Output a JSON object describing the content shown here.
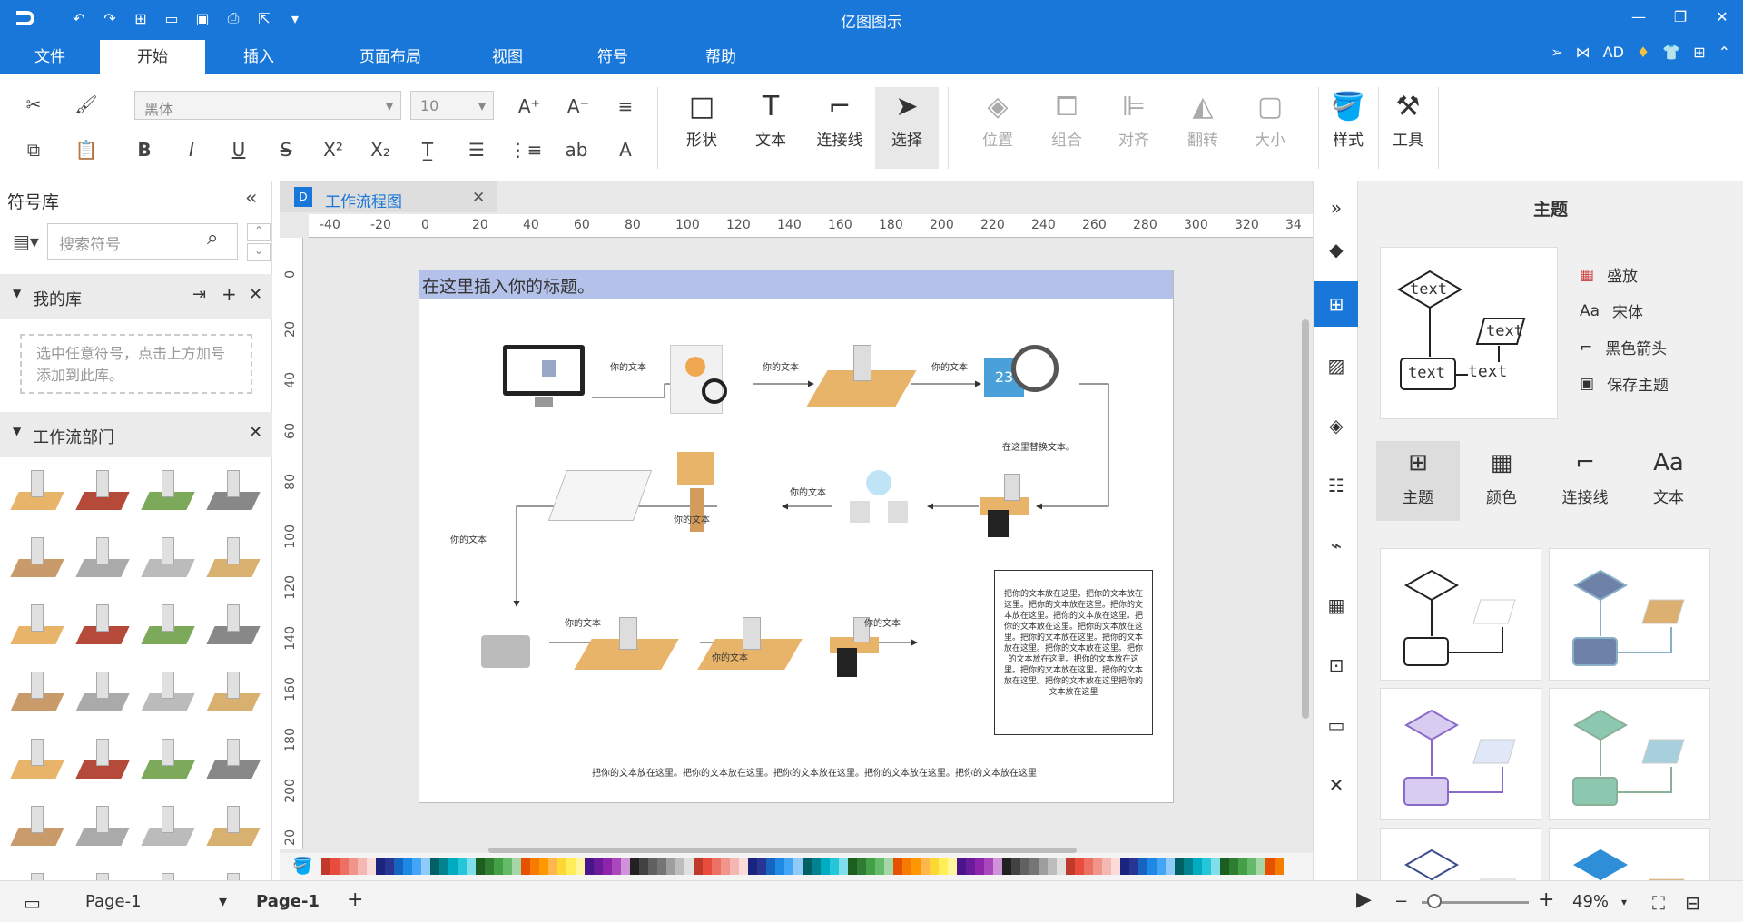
{
  "app": {
    "title": "亿图图示"
  },
  "tabs": [
    {
      "label": "文件"
    },
    {
      "label": "开始"
    },
    {
      "label": "插入"
    },
    {
      "label": "页面布局"
    },
    {
      "label": "视图"
    },
    {
      "label": "符号"
    },
    {
      "label": "帮助"
    }
  ],
  "user": {
    "name": "AD"
  },
  "ribbon": {
    "font_name": "黑体",
    "font_size": "10",
    "big": [
      {
        "label": "形状"
      },
      {
        "label": "文本"
      },
      {
        "label": "连接线"
      },
      {
        "label": "选择"
      },
      {
        "label": "位置"
      },
      {
        "label": "组合"
      },
      {
        "label": "对齐"
      },
      {
        "label": "翻转"
      },
      {
        "label": "大小"
      },
      {
        "label": "样式"
      },
      {
        "label": "工具"
      }
    ]
  },
  "left": {
    "title": "符号库",
    "search_placeholder": "搜索符号",
    "my_lib": "我的库",
    "drop_hint": "选中任意符号，点击上方加号添加到此库。",
    "dept": "工作流部门"
  },
  "doc": {
    "tab": "工作流程图"
  },
  "ruler": {
    "h": [
      "-40",
      "-20",
      "0",
      "20",
      "40",
      "60",
      "80",
      "100",
      "120",
      "140",
      "160",
      "180",
      "200",
      "220",
      "240",
      "260",
      "280",
      "300",
      "320",
      "34"
    ],
    "v": [
      "0",
      "20",
      "40",
      "60",
      "80",
      "100",
      "120",
      "140",
      "160",
      "180",
      "200",
      "20"
    ]
  },
  "diagram": {
    "header": "在这里插入你的标题。",
    "label": "你的文本",
    "replace": "在这里替换文本。",
    "box": "把你的文本放在这里。把你的文本放在这里。把你的文本放在这里。把你的文本放在这里。把你的文本放在这里。把你的文本放在这里。把你的文本放在这里。把你的文本放在这里。把你的文本放在这里。把你的文本放在这里。把你的文本放在这里。把你的文本放在这里。把你的文本放在这里。把你的文本放在这里。把你的文本放在这里把你的文本放在这里",
    "footer": "把你的文本放在这里。把你的文本放在这里。把你的文本放在这里。把你的文本放在这里。把你的文本放在这里"
  },
  "theme": {
    "title": "主题",
    "preview_text": "text",
    "options": [
      {
        "label": "盛放"
      },
      {
        "label": "宋体"
      },
      {
        "label": "黑色箭头"
      },
      {
        "label": "保存主题"
      }
    ],
    "tabs": [
      {
        "label": "主题"
      },
      {
        "label": "颜色"
      },
      {
        "label": "连接线"
      },
      {
        "label": "文本"
      }
    ]
  },
  "status": {
    "page_select": "Page-1",
    "page_tab": "Page-1",
    "zoom": "49%"
  },
  "colors": {
    "accent": "#1877d8",
    "header_bar": "#b4c2ea"
  }
}
